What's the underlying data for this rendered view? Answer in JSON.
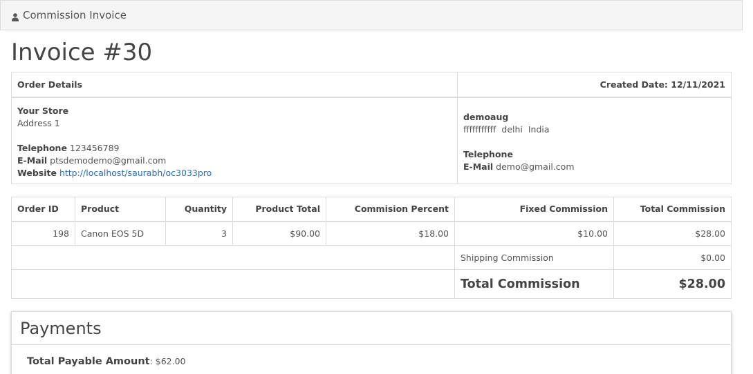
{
  "panel": {
    "title": "Commission Invoice",
    "icon": "user-icon"
  },
  "invoice": {
    "title": "Invoice #30"
  },
  "details": {
    "order_details_label": "Order Details",
    "created_date": "Created Date: 12/11/2021",
    "store": {
      "name": "Your Store",
      "address": "Address 1",
      "telephone_label": "Telephone",
      "telephone": "123456789",
      "email_label": "E-Mail",
      "email": "ptsdemodemo@gmail.com",
      "website_label": "Website",
      "website": "http://localhost/saurabh/oc3033pro"
    },
    "customer": {
      "name": "demoaug",
      "address": "fffffffffff  delhi  India",
      "telephone_label": "Telephone",
      "email_label": "E-Mail",
      "email": "demo@gmail.com"
    }
  },
  "products": {
    "headers": [
      "Order ID",
      "Product",
      "Quantity",
      "Product Total",
      "Commision Percent",
      "Fixed Commission",
      "Total Commission"
    ],
    "rows": [
      {
        "order_id": "198",
        "product": "Canon EOS 5D",
        "quantity": "3",
        "product_total": "$90.00",
        "commission_percent": "$18.00",
        "fixed_commission": "$10.00",
        "total_commission": "$28.00"
      }
    ],
    "shipping_label": "Shipping Commission",
    "shipping_value": "$0.00",
    "total_label": "Total Commission",
    "total_value": "$28.00"
  },
  "payments": {
    "title": "Payments",
    "payable_label": "Total Payable Amount",
    "payable_value": ": $62.00"
  }
}
